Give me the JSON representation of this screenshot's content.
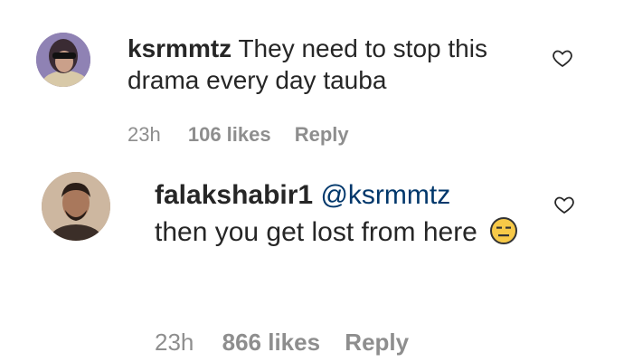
{
  "comments": [
    {
      "username": "ksrmmtz",
      "text": "They need to stop this drama every day tauba",
      "time": "23h",
      "likes": "106 likes",
      "reply": "Reply",
      "avatar_icon": "user-avatar",
      "like_icon": "heart-outline-icon"
    },
    {
      "username": "falakshabir1",
      "mention": "@ksrmmtz",
      "text": "then you get lost from here",
      "emoji": "expressionless-face",
      "time": "23h",
      "likes": "866 likes",
      "reply": "Reply",
      "avatar_icon": "user-avatar",
      "like_icon": "heart-outline-icon"
    }
  ],
  "colors": {
    "text": "#262626",
    "meta": "#8e8e8e",
    "mention": "#00376b",
    "emoji_face": "#f7c948"
  }
}
